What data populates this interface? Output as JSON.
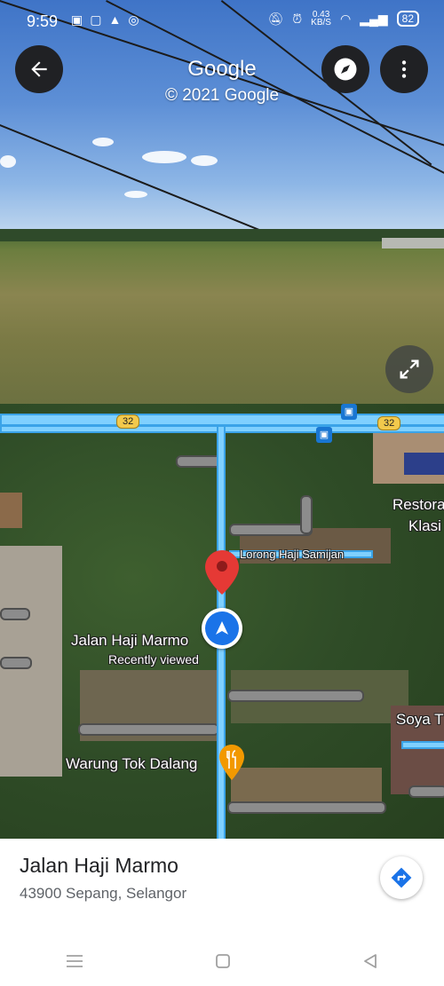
{
  "status": {
    "time": "9:59",
    "network_speed": "0.43",
    "network_unit": "KB/S",
    "battery": "82"
  },
  "streetview": {
    "title": "Google",
    "copyright": "© 2021 Google"
  },
  "map": {
    "road_shield": "32",
    "labels": {
      "street_lorong": "Lorong Haji Samijan",
      "street_jalan": "Jalan Haji Marmo",
      "recently_viewed": "Recently viewed",
      "warung": "Warung Tok Dalang",
      "restoran_1": "Restora",
      "restoran_2": "Klasi",
      "soya": "Soya T"
    }
  },
  "place": {
    "name": "Jalan Haji Marmo",
    "address": "43900 Sepang, Selangor"
  },
  "icons": {
    "back": "arrow-left-icon",
    "compass": "compass-icon",
    "more": "more-vert-icon",
    "expand": "expand-icon",
    "directions": "directions-icon",
    "pin": "location-pin-icon",
    "navigation": "navigation-arrow-icon",
    "restaurant": "restaurant-icon"
  },
  "colors": {
    "accent_blue": "#1a73e8",
    "pin_red": "#e53935",
    "restaurant_orange": "#f29900"
  }
}
